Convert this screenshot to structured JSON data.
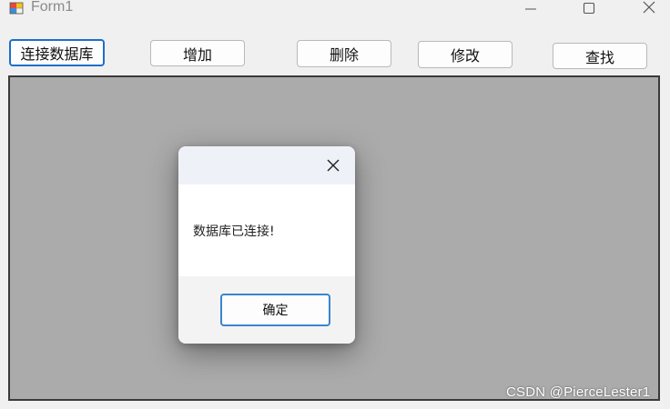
{
  "window": {
    "title": "Form1",
    "icon": "form-app-icon",
    "controls": [
      "minimize-icon",
      "maximize-icon",
      "close-icon"
    ]
  },
  "toolbar": {
    "connect_label": "连接数据库",
    "add_label": "增加",
    "delete_label": "删除",
    "modify_label": "修改",
    "search_label": "查找"
  },
  "dialog": {
    "message": "数据库已连接!",
    "ok_label": "确定",
    "close_icon": "close-icon"
  },
  "watermark": "CSDN @PierceLester1",
  "colors": {
    "panel": "#ababab",
    "focus_border": "#1e6fc8",
    "dialog_header": "#eef1f8"
  }
}
